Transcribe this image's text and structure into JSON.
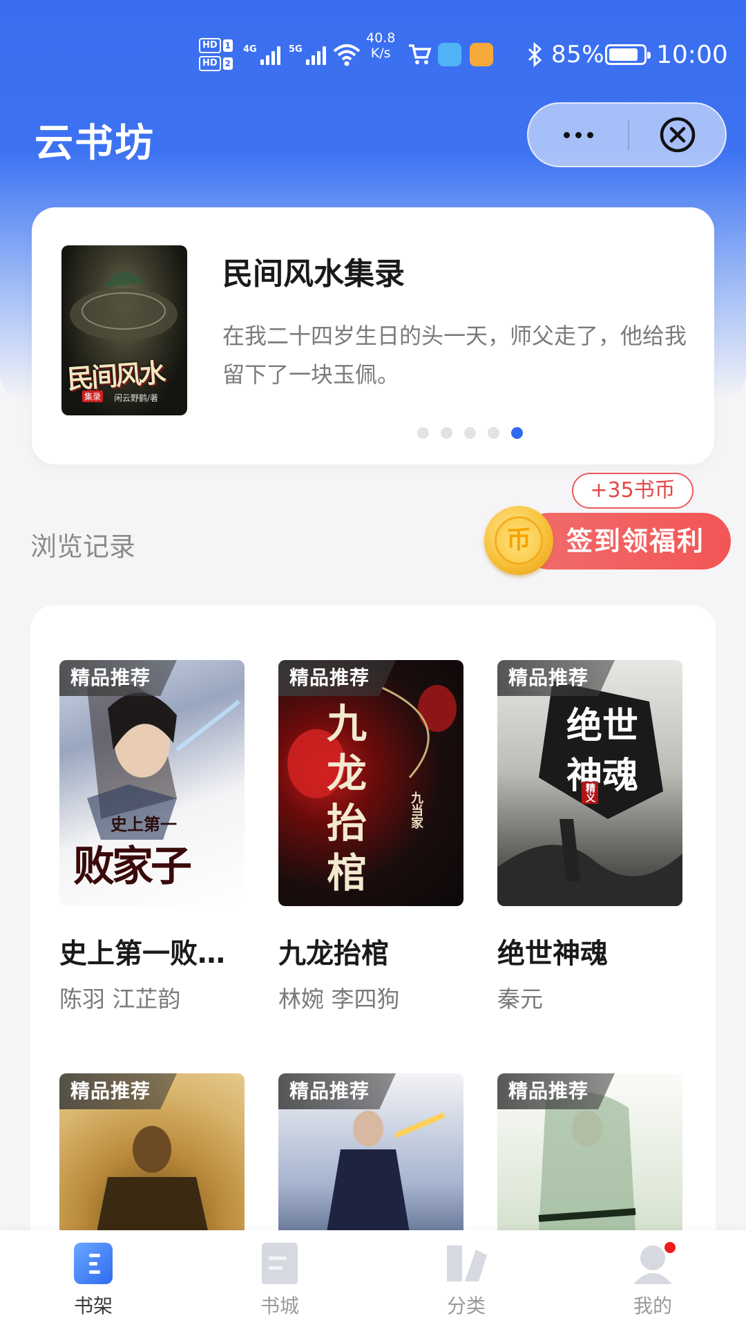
{
  "status_bar": {
    "hd1": "HD",
    "hd1_num": "1",
    "hd2": "HD",
    "hd2_num": "2",
    "net1": "4G",
    "net2": "5G",
    "speed_value": "40.8",
    "speed_unit": "K/s",
    "battery_text": "85%",
    "battery_level": 0.85,
    "time": "10:00"
  },
  "header": {
    "title": "云书坊"
  },
  "featured": {
    "title": "民间风水集录",
    "description": "在我二十四岁生日的头一天，师父走了，他给我留下了一块玉佩。",
    "cover_title": "民间风水",
    "cover_badge": "集录",
    "cover_author": "闲云野鹤/著",
    "carousel_count": 5,
    "carousel_active": 5
  },
  "history": {
    "label": "浏览记录",
    "coin_tip": "+35书币",
    "coin_glyph": "币",
    "checkin_label": "签到领福利"
  },
  "books": [
    {
      "tag": "精品推荐",
      "title": "史上第一败家子",
      "author": "陈羽 江芷韵",
      "cover_text": "败家子",
      "cover_sub": "史上第一"
    },
    {
      "tag": "精品推荐",
      "title": "九龙抬棺",
      "author": "林婉 李四狗",
      "cover_text": "九龙抬棺",
      "cover_sub": "九当家"
    },
    {
      "tag": "精品推荐",
      "title": "绝世神魂",
      "author": "秦元",
      "cover_text": "绝世神魂",
      "cover_sub": "精义"
    },
    {
      "tag": "精品推荐",
      "title": "",
      "author": ""
    },
    {
      "tag": "精品推荐",
      "title": "",
      "author": ""
    },
    {
      "tag": "精品推荐",
      "title": "",
      "author": ""
    }
  ],
  "tabbar": {
    "items": [
      {
        "label": "书架",
        "icon": "bookshelf-icon",
        "active": true
      },
      {
        "label": "书城",
        "icon": "bookstore-icon",
        "active": false
      },
      {
        "label": "分类",
        "icon": "category-icon",
        "active": false
      },
      {
        "label": "我的",
        "icon": "profile-icon",
        "active": false,
        "badge": true
      }
    ]
  },
  "colors": {
    "brand_blue": "#3a6ef0",
    "carousel_active": "#2f6bef",
    "checkin_red": "#f25555",
    "coin_gold": "#f8c13a"
  }
}
